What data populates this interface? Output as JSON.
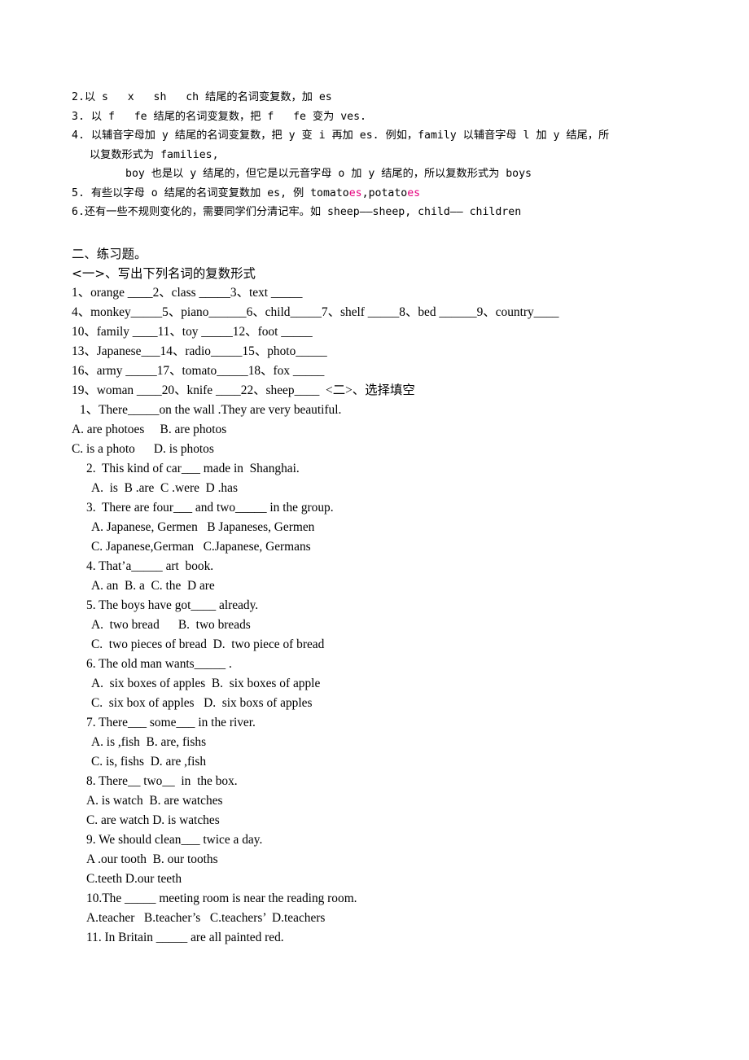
{
  "document": {
    "type": "worksheet",
    "subject": "English noun plural forms (Chinese-language grammar worksheet)",
    "background_color": "#ffffff",
    "text_color": "#000000",
    "highlight_color": "#e6007e"
  },
  "rules": {
    "lines": [
      {
        "id": "rule-2",
        "text": "2.以 s   x   sh   ch 结尾的名词变复数，加 es",
        "indent": 0
      },
      {
        "id": "rule-3",
        "text": "3. 以 f   fe 结尾的名词变复数，把 f   fe 变为 ves.",
        "indent": 0
      },
      {
        "id": "rule-4",
        "text": "4. 以辅音字母加 y 结尾的名词变复数，把 y 变 i 再加 es. 例如，family 以辅音字母 l 加 y 结尾，所",
        "indent": 0
      },
      {
        "id": "rule-4-cont",
        "text": "以复数形式为 families,",
        "indent": 1
      },
      {
        "id": "rule-4-boy",
        "text": "boy 也是以 y 结尾的，但它是以元音字母 o 加 y 结尾的，所以复数形式为 boys",
        "indent": 2
      },
      {
        "id": "rule-5",
        "text": "5. 有些以字母 o 结尾的名词变复数加 es, 例 tomato",
        "indent": 0,
        "highlight_1": "es",
        "text_mid": ",potato",
        "highlight_2": "es"
      },
      {
        "id": "rule-6",
        "text": "6.还有一些不规则变化的，需要同学们分清记牢。如 sheep——sheep, child—— children",
        "indent": 0
      }
    ]
  },
  "exercises": {
    "section_heading": "二、练习题。",
    "part_one_heading": "<一>、写出下列名词的复数形式",
    "fill_in_lines": [
      "1、orange ____2、class _____3、text _____",
      "4、monkey_____5、piano______6、child_____7、shelf _____8、bed ______9、country____",
      "10、family ____11、toy _____12、foot _____",
      "13、Japanese___14、radio_____15、photo_____",
      "16、army _____17、tomato_____18、fox _____",
      "19、woman ____20、knife ____22、sheep____  <二>、选择填空"
    ],
    "multiple_choice": [
      {
        "number": "1",
        "stem": "1、There_____on the wall .They are very beautiful.",
        "stem_indent": 1,
        "options": [
          {
            "text": "A. are photoes     B. are photos",
            "indent": 0
          },
          {
            "text": "C. is a photo      D. is photos",
            "indent": 0
          }
        ]
      },
      {
        "number": "2",
        "stem": "2.  This kind of car___ made in  Shanghai.",
        "stem_indent": 2,
        "options": [
          {
            "text": "A.  is  B .are  C .were  D .has",
            "indent": 3
          }
        ]
      },
      {
        "number": "3",
        "stem": "3.  There are four___ and two_____ in the group.",
        "stem_indent": 2,
        "options": [
          {
            "text": "A. Japanese, Germen   B Japaneses, Germen",
            "indent": 3
          },
          {
            "text": "C. Japanese,German   C.Japanese, Germans",
            "indent": 3
          }
        ]
      },
      {
        "number": "4",
        "stem": "4. That’a_____ art  book.",
        "stem_indent": 2,
        "options": [
          {
            "text": "A. an  B. a  C. the  D are",
            "indent": 3
          }
        ]
      },
      {
        "number": "5",
        "stem": "5. The boys have got____ already.",
        "stem_indent": 2,
        "options": [
          {
            "text": "A.  two bread      B.  two breads",
            "indent": 3
          },
          {
            "text": "C.  two pieces of bread  D.  two piece of bread",
            "indent": 3
          }
        ]
      },
      {
        "number": "6",
        "stem": "6. The old man wants_____ .",
        "stem_indent": 2,
        "options": [
          {
            "text": "A.  six boxes of apples  B.  six boxes of apple",
            "indent": 3
          },
          {
            "text": "C.  six box of apples   D.  six boxs of apples",
            "indent": 3
          }
        ]
      },
      {
        "number": "7",
        "stem": "7. There___ some___ in the river.",
        "stem_indent": 2,
        "options": [
          {
            "text": "A. is ,fish  B. are, fishs",
            "indent": 3
          },
          {
            "text": "C. is, fishs  D. are ,fish",
            "indent": 3
          }
        ]
      },
      {
        "number": "8",
        "stem": "8. There__ two__  in  the box.",
        "stem_indent": 2,
        "options": [
          {
            "text": "A. is watch  B. are watches",
            "indent": 2
          },
          {
            "text": "C. are watch D. is watches",
            "indent": 2
          }
        ]
      },
      {
        "number": "9",
        "stem": "9. We should clean___ twice a day.",
        "stem_indent": 2,
        "options": [
          {
            "text": "A .our tooth  B. our tooths",
            "indent": 2
          },
          {
            "text": "C.teeth D.our teeth",
            "indent": 2
          }
        ]
      },
      {
        "number": "10",
        "stem": "10.The _____ meeting room is near the reading room.",
        "stem_indent": 2,
        "options": [
          {
            "text": "A.teacher   B.teacher’s   C.teachers’  D.teachers",
            "indent": 2
          }
        ]
      },
      {
        "number": "11",
        "stem": "11. In Britain _____ are all painted red.",
        "stem_indent": 2,
        "options": []
      }
    ]
  }
}
